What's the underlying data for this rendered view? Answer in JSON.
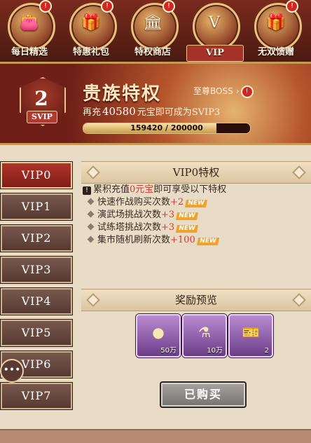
{
  "top_nav": [
    {
      "label": "每日精选",
      "glyph": "👛",
      "badge": "!"
    },
    {
      "label": "特惠礼包",
      "glyph": "🎁",
      "badge": "!"
    },
    {
      "label": "特权商店",
      "glyph": "🏛",
      "badge": "!"
    },
    {
      "label": "VIP",
      "glyph": "V",
      "badge": ""
    },
    {
      "label": "无双馈赠",
      "glyph": "🎁",
      "badge": "!"
    }
  ],
  "banner": {
    "svip_level": "2",
    "svip_label": "SVIP",
    "title": "贵族特权",
    "boss_label": "至尊BOSS",
    "boss_badge": "!",
    "recharge_prefix": "再充",
    "recharge_amount": "40580",
    "recharge_suffix": "元宝即可成为SVIP3",
    "progress_text": "159420 / 200000",
    "progress_fraction": 0.797
  },
  "sidebar": {
    "tabs": [
      "VIP0",
      "VIP1",
      "VIP2",
      "VIP3",
      "VIP4",
      "VIP5",
      "VIP6",
      "VIP7"
    ],
    "active": "VIP0",
    "chat_icon": "chat-bubble-icon"
  },
  "privileges": {
    "header": "VIP0特权",
    "intro_prefix": "累积充值",
    "intro_value": "0元宝",
    "intro_suffix": "即可享受以下特权",
    "items": [
      {
        "label": "快速作战购买次数",
        "value": "+2",
        "tag": "NEW"
      },
      {
        "label": "演武场挑战次数",
        "value": "+3",
        "tag": "NEW"
      },
      {
        "label": "试练塔挑战次数",
        "value": "+3",
        "tag": "NEW"
      },
      {
        "label": "集市随机刷新次数",
        "value": "+100",
        "tag": "NEW"
      }
    ]
  },
  "rewards": {
    "header": "奖励预览",
    "items": [
      {
        "icon": "coin-icon",
        "glyph": "●",
        "qty": "50万"
      },
      {
        "icon": "potion-icon",
        "glyph": "⚗",
        "qty": "10万"
      },
      {
        "icon": "ticket-icon",
        "glyph": "🎫",
        "qty": "2"
      }
    ]
  },
  "buy_button": {
    "label": "已购买"
  }
}
